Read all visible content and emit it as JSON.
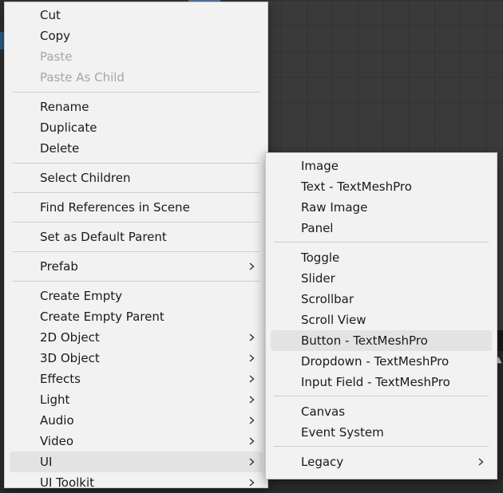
{
  "main_menu": {
    "items": [
      {
        "label": "Cut"
      },
      {
        "label": "Copy"
      },
      {
        "label": "Paste"
      },
      {
        "label": "Paste As Child"
      },
      {
        "label": "Rename"
      },
      {
        "label": "Duplicate"
      },
      {
        "label": "Delete"
      },
      {
        "label": "Select Children"
      },
      {
        "label": "Find References in Scene"
      },
      {
        "label": "Set as Default Parent"
      },
      {
        "label": "Prefab"
      },
      {
        "label": "Create Empty"
      },
      {
        "label": "Create Empty Parent"
      },
      {
        "label": "2D Object"
      },
      {
        "label": "3D Object"
      },
      {
        "label": "Effects"
      },
      {
        "label": "Light"
      },
      {
        "label": "Audio"
      },
      {
        "label": "Video"
      },
      {
        "label": "UI"
      },
      {
        "label": "UI Toolkit"
      }
    ]
  },
  "ui_submenu": {
    "items": [
      {
        "label": "Image"
      },
      {
        "label": "Text - TextMeshPro"
      },
      {
        "label": "Raw Image"
      },
      {
        "label": "Panel"
      },
      {
        "label": "Toggle"
      },
      {
        "label": "Slider"
      },
      {
        "label": "Scrollbar"
      },
      {
        "label": "Scroll View"
      },
      {
        "label": "Button - TextMeshPro"
      },
      {
        "label": "Dropdown - TextMeshPro"
      },
      {
        "label": "Input Field - TextMeshPro"
      },
      {
        "label": "Canvas"
      },
      {
        "label": "Event System"
      },
      {
        "label": "Legacy"
      }
    ]
  },
  "colors": {
    "menu_bg": "#f2f2f2",
    "highlight": "#e3e3e3",
    "disabled_text": "#a6a6a6"
  }
}
